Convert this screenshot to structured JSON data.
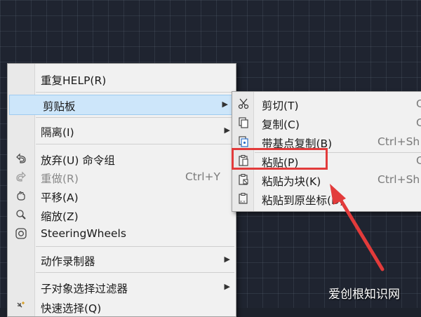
{
  "menu": {
    "items": [
      {
        "label": "重复HELP(R)"
      },
      {
        "label": "剪贴板"
      },
      {
        "label": "隔离(I)"
      },
      {
        "label": "放弃(U) 命令组"
      },
      {
        "label": "重做(R)",
        "shortcut": "Ctrl+Y"
      },
      {
        "label": "平移(A)"
      },
      {
        "label": "缩放(Z)"
      },
      {
        "label": "SteeringWheels"
      },
      {
        "label": "动作录制器"
      },
      {
        "label": "子对象选择过滤器"
      },
      {
        "label": "快速选择(Q)"
      }
    ]
  },
  "submenu": {
    "items": [
      {
        "label": "剪切(T)",
        "shortcut": "C"
      },
      {
        "label": "复制(C)",
        "shortcut": "C"
      },
      {
        "label": "带基点复制(B)",
        "shortcut": "Ctrl+Sh"
      },
      {
        "label": "粘贴(P)",
        "shortcut": "C"
      },
      {
        "label": "粘贴为块(K)",
        "shortcut": "Ctrl+Sh"
      },
      {
        "label": "粘贴到原坐标(D)"
      }
    ]
  },
  "annotation": {
    "color": "#e23b3b"
  },
  "watermark": "爱创根知识网"
}
